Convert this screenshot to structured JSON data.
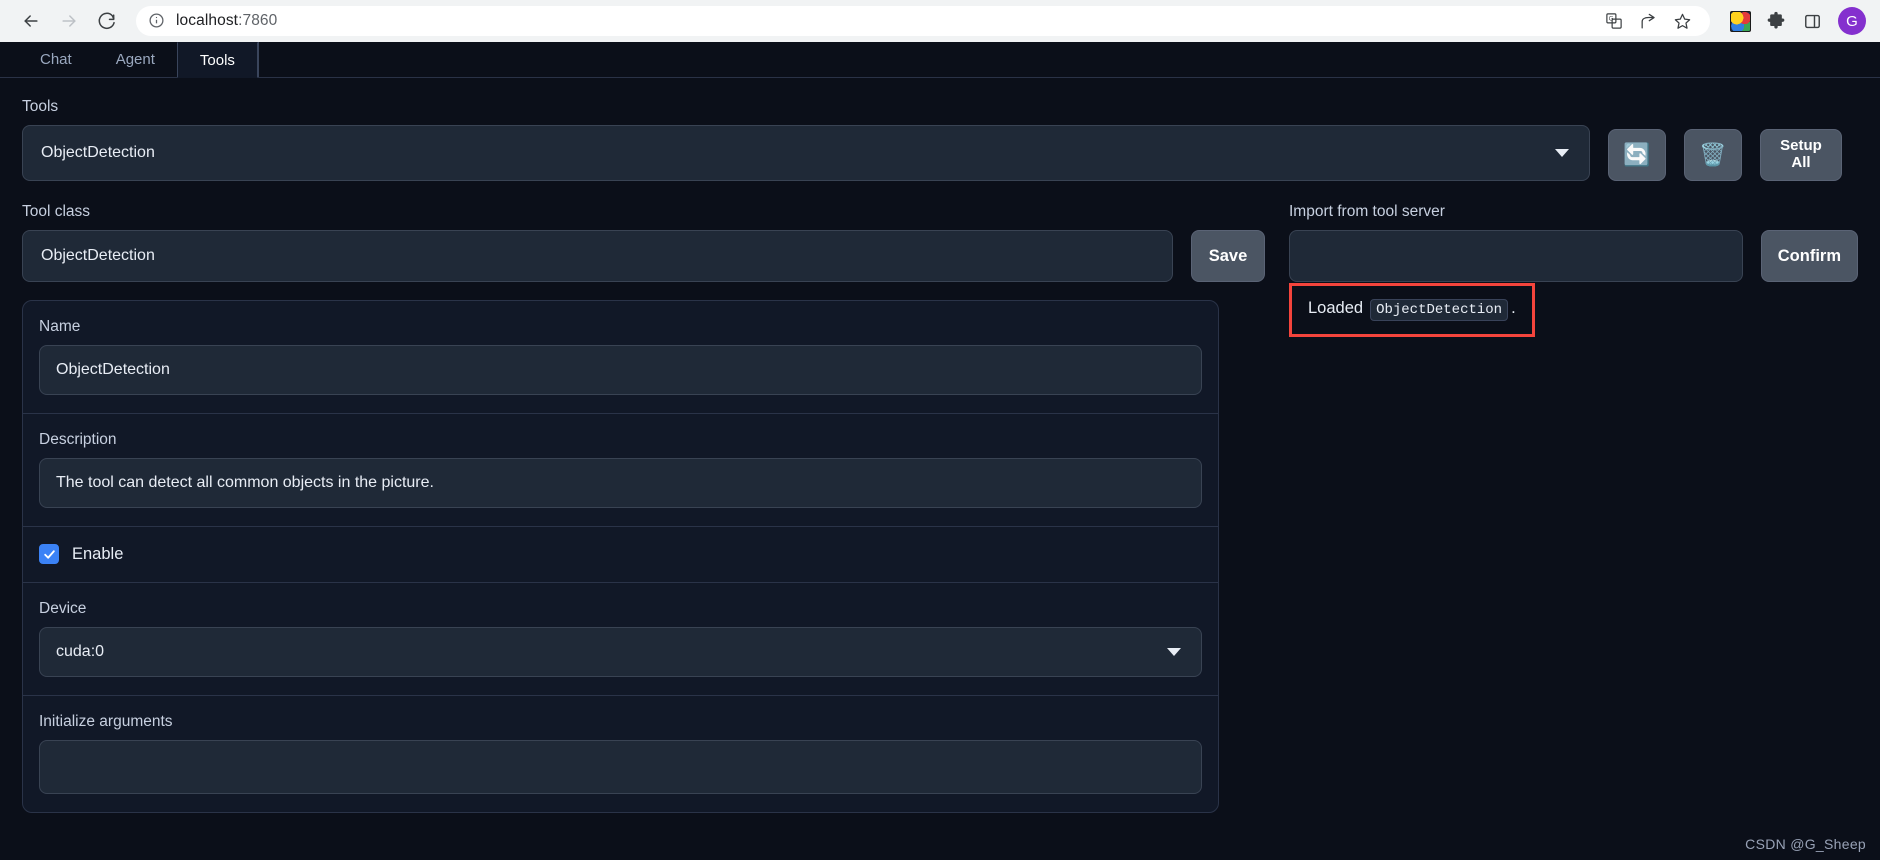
{
  "browser": {
    "back_icon": "back-arrow-icon",
    "forward_icon": "forward-arrow-icon",
    "reload_icon": "reload-icon",
    "site_info_icon": "site-info-icon",
    "url_host": "localhost",
    "url_port": ":7860",
    "url_full": "localhost:7860",
    "actions": [
      {
        "name": "translate-icon",
        "glyph": "文"
      },
      {
        "name": "share-icon",
        "glyph": "↪"
      },
      {
        "name": "bookmark-star-icon",
        "glyph": "☆"
      }
    ],
    "extension_icon": "colorful-globe-extension-icon",
    "puzzle_icon": "extensions-puzzle-icon",
    "sidepanel_icon": "side-panel-icon",
    "profile_initial": "G",
    "profile_color": "#8430ce"
  },
  "tabs": [
    {
      "label": "Chat",
      "active": false
    },
    {
      "label": "Agent",
      "active": false
    },
    {
      "label": "Tools",
      "active": true
    }
  ],
  "tools_selector": {
    "label": "Tools",
    "value": "ObjectDetection",
    "caret_icon": "chevron-down-icon"
  },
  "toolbar_buttons": [
    {
      "name": "refresh-button",
      "icon": "refresh-arrows-icon",
      "glyph": "🔄"
    },
    {
      "name": "delete-button",
      "icon": "trash-can-icon",
      "glyph": "🗑️"
    },
    {
      "name": "setup-all-button",
      "label_line1": "Setup",
      "label_line2": "All"
    }
  ],
  "tool_class": {
    "label": "Tool class",
    "value": "ObjectDetection",
    "save_label": "Save"
  },
  "import_server": {
    "label": "Import from tool server",
    "value": "",
    "placeholder": "",
    "confirm_label": "Confirm"
  },
  "status": {
    "prefix": "Loaded",
    "code": "ObjectDetection",
    "suffix": ".",
    "highlight_color": "#f4443c"
  },
  "form": {
    "name": {
      "label": "Name",
      "value": "ObjectDetection"
    },
    "description": {
      "label": "Description",
      "value": "The tool can detect all common objects in the picture."
    },
    "enable": {
      "label": "Enable",
      "checked": true,
      "accent": "#3b82f6",
      "check_icon": "checkmark-icon"
    },
    "device": {
      "label": "Device",
      "value": "cuda:0",
      "caret_icon": "chevron-down-icon"
    },
    "init_args": {
      "label": "Initialize arguments",
      "value": "",
      "placeholder": ""
    }
  },
  "watermark": "CSDN @G_Sheep"
}
